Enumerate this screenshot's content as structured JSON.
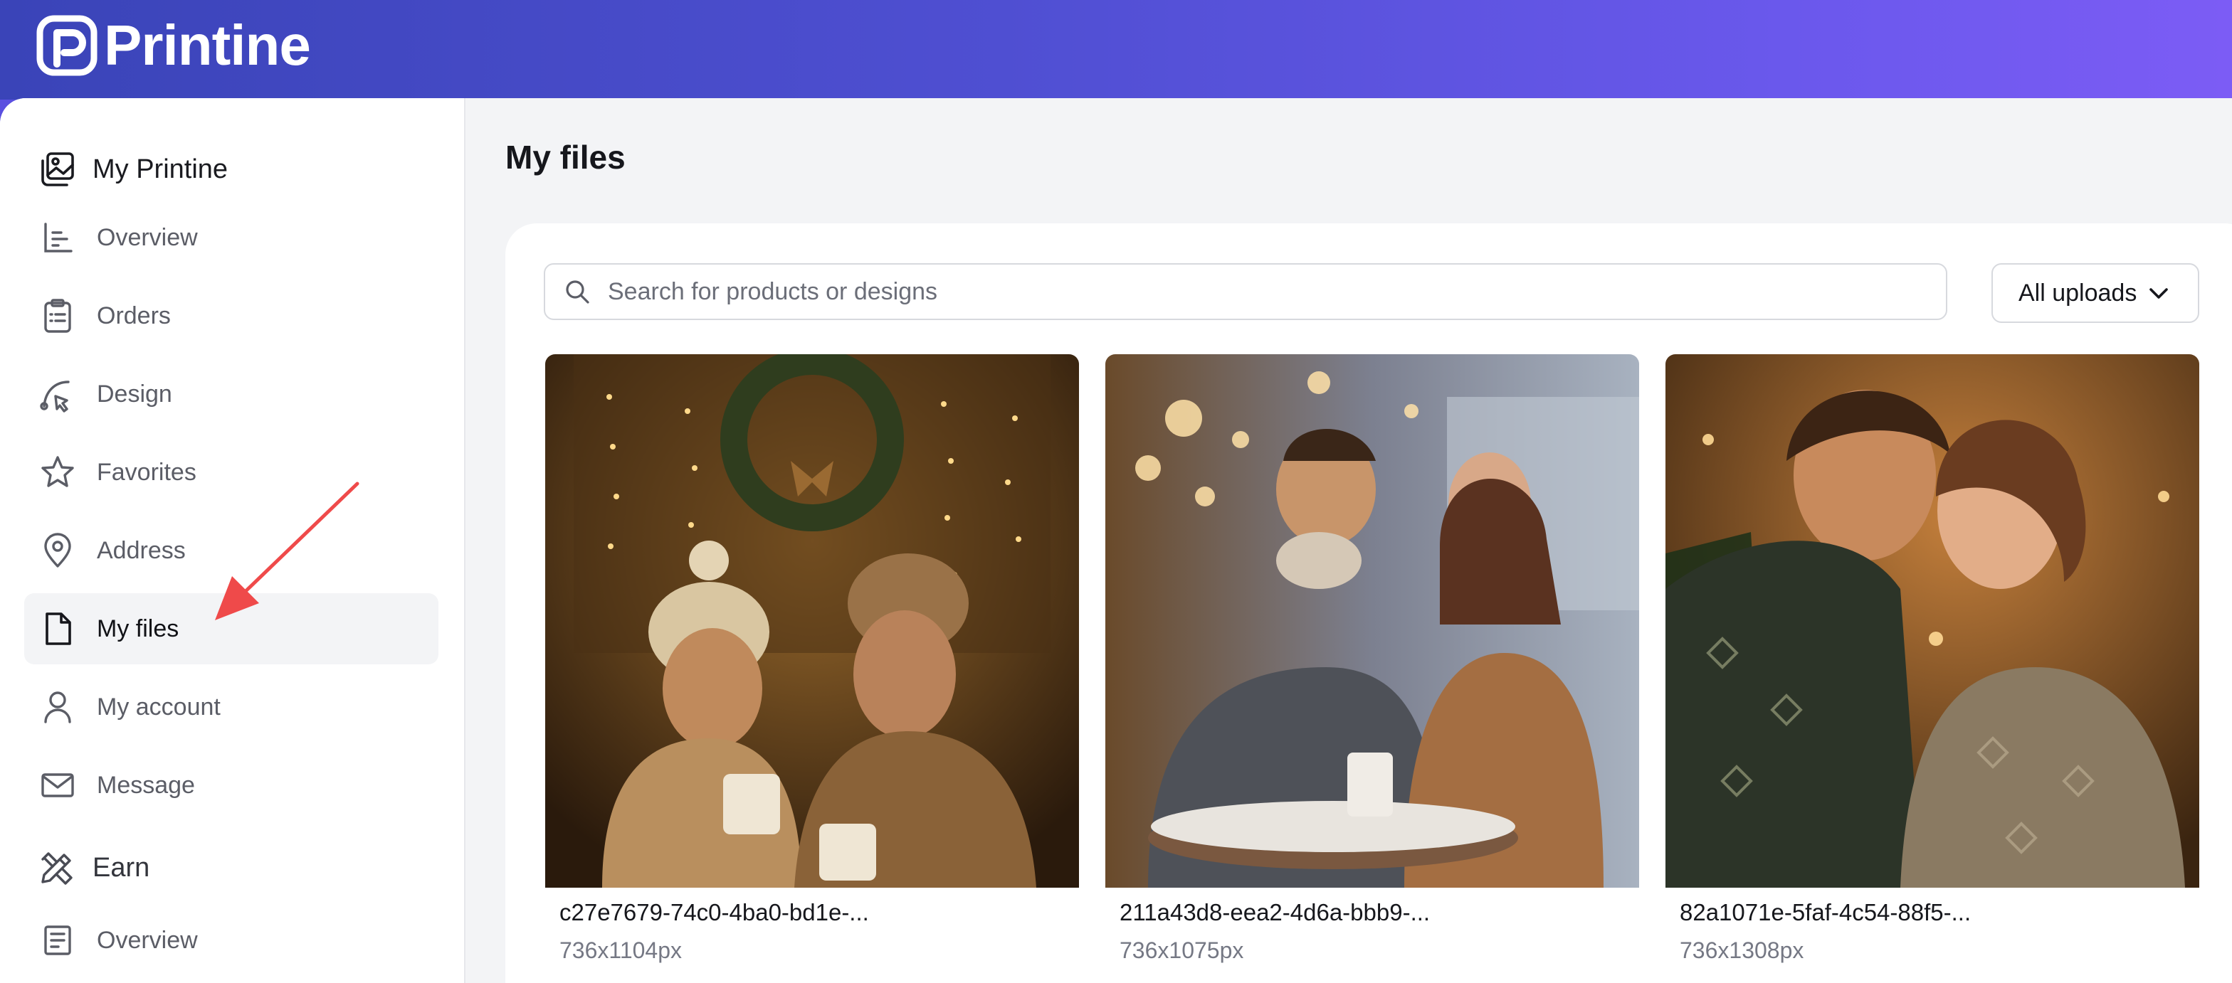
{
  "brand": {
    "name": "Printine",
    "accent": "#5a4fe0"
  },
  "sidebar": {
    "my_printine": {
      "label": "My Printine",
      "icon": "image-gallery-icon",
      "items": [
        {
          "label": "Overview",
          "icon": "chart-icon"
        },
        {
          "label": "Orders",
          "icon": "clipboard-icon"
        },
        {
          "label": "Design",
          "icon": "pen-tool-icon"
        },
        {
          "label": "Favorites",
          "icon": "star-icon"
        },
        {
          "label": "Address",
          "icon": "location-pin-icon"
        },
        {
          "label": "My files",
          "icon": "file-icon",
          "active": true
        },
        {
          "label": "My account",
          "icon": "user-icon"
        },
        {
          "label": "Message",
          "icon": "mail-icon"
        }
      ]
    },
    "earn": {
      "label": "Earn",
      "icon": "earn-tools-icon",
      "items": [
        {
          "label": "Overview",
          "icon": "document-icon"
        }
      ]
    }
  },
  "main": {
    "title": "My files",
    "search": {
      "placeholder": "Search for products or designs",
      "value": ""
    },
    "filter": {
      "selected": "All uploads"
    },
    "files": [
      {
        "name": "c27e7679-74c0-4ba0-bd1e-...",
        "dims": "736x1104px"
      },
      {
        "name": "211a43d8-eea2-4d6a-bbb9-...",
        "dims": "736x1075px"
      },
      {
        "name": "82a1071e-5faf-4c54-88f5-...",
        "dims": "736x1308px"
      }
    ]
  }
}
